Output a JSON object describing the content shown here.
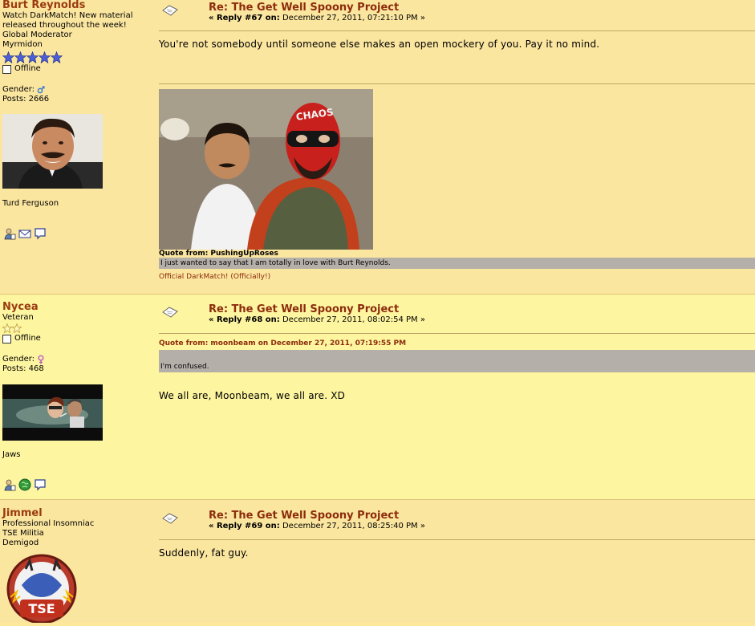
{
  "posts": [
    {
      "poster": {
        "name": "Burt Reynolds",
        "custom_title_1": "Watch DarkMatch! New material",
        "custom_title_2": "released throughout the week!",
        "group": "Global Moderator",
        "post_group": "Myrmidon",
        "status": "Offline",
        "gender_label": "Gender:",
        "posts_label": "Posts: 2666",
        "personal_text": "Turd Ferguson"
      },
      "subject": "Re: The Get Well Spoony Project",
      "reply_label": "« Reply #67 on:",
      "date": "December 27, 2011, 07:21:10 PM »",
      "body": "You're not somebody until someone else makes an open mockery of you.  Pay it no mind.",
      "sig_image_text": "CHAOS",
      "quote_header": "Quote from: PushingUpRoses",
      "quote_text": "I just wanted to say that I am totally in love with Burt Reynolds.",
      "sig_link": "Official DarkMatch!  (Officially!)"
    },
    {
      "poster": {
        "name": "Nycea",
        "group": "Veteran",
        "status": "Offline",
        "gender_label": "Gender:",
        "posts_label": "Posts: 468",
        "personal_text": "Jaws"
      },
      "subject": "Re: The Get Well Spoony Project",
      "reply_label": "« Reply #68 on:",
      "date": "December 27, 2011, 08:02:54 PM »",
      "quote_header": "Quote from: moonbeam on December 27, 2011, 07:19:55 PM",
      "quote_text": "I'm confused.",
      "body": "We all are, Moonbeam, we all are. XD"
    },
    {
      "poster": {
        "name": "Jimmel",
        "custom_title_1": "Professional Insomniac",
        "custom_title_2": "TSE Militia",
        "group": "Demigod",
        "avatar_text": "TSE"
      },
      "subject": "Re: The Get Well Spoony Project",
      "reply_label": "« Reply #69 on:",
      "date": "December 27, 2011, 08:25:40 PM »",
      "body": "Suddenly, fat guy."
    }
  ],
  "colors": {
    "username": "#9a3b10",
    "subject": "#8c2c0c",
    "quote_bg": "#b5afa9",
    "star": "#4b5fd6"
  },
  "icons": [
    "message-icon",
    "profile-icon",
    "email-icon",
    "pm-icon",
    "website-icon",
    "male-icon",
    "female-icon",
    "star-icon"
  ]
}
